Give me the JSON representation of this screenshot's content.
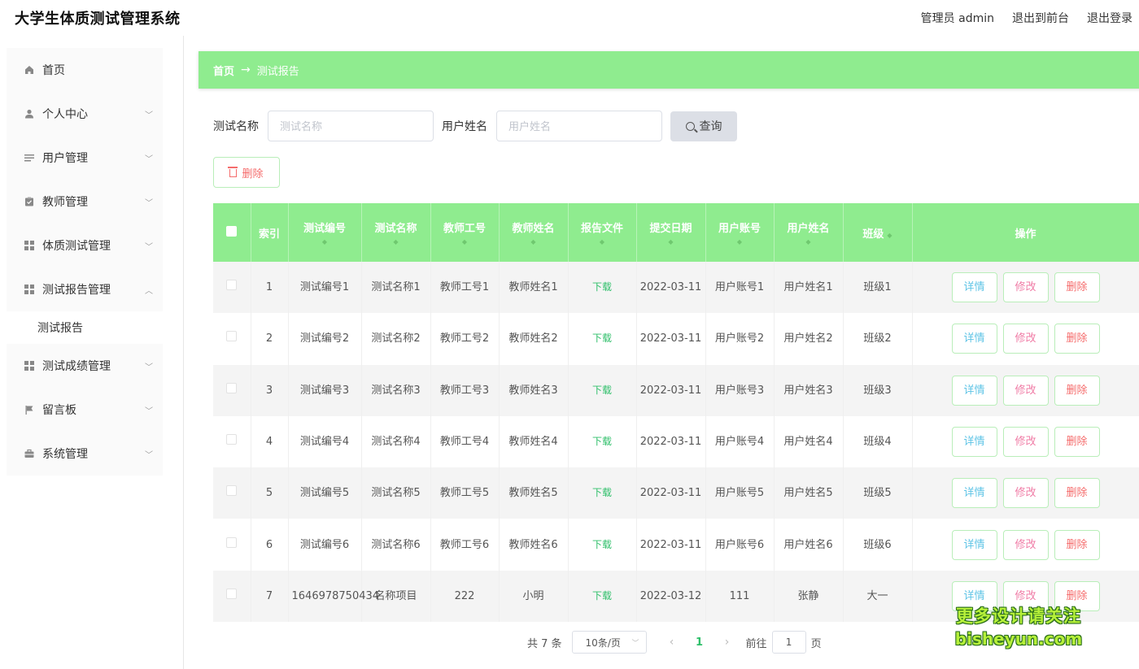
{
  "app": {
    "title": "大学生体质测试管理系统",
    "admin_label": "管理员 admin",
    "front_label": "退出到前台",
    "logout_label": "退出登录"
  },
  "sidebar": {
    "items": [
      {
        "label": "首页",
        "icon": "home-icon"
      },
      {
        "label": "个人中心",
        "icon": "user-icon"
      },
      {
        "label": "用户管理",
        "icon": "list-icon"
      },
      {
        "label": "教师管理",
        "icon": "clipboard-icon"
      },
      {
        "label": "体质测试管理",
        "icon": "grid-icon"
      },
      {
        "label": "测试报告管理",
        "icon": "grid-icon"
      },
      {
        "label": "测试报告",
        "icon": ""
      },
      {
        "label": "测试成绩管理",
        "icon": "grid-icon"
      },
      {
        "label": "留言板",
        "icon": "flag-icon"
      },
      {
        "label": "系统管理",
        "icon": "briefcase-icon"
      }
    ]
  },
  "breadcrumb": {
    "home": "首页",
    "arrow": "→",
    "current": "测试报告"
  },
  "search": {
    "name_label": "测试名称",
    "name_placeholder": "测试名称",
    "user_label": "用户姓名",
    "user_placeholder": "用户姓名",
    "query_label": "查询"
  },
  "toolbar": {
    "delete_label": "删除"
  },
  "table": {
    "headers": [
      "索引",
      "测试编号",
      "测试名称",
      "教师工号",
      "教师姓名",
      "报告文件",
      "提交日期",
      "用户账号",
      "用户姓名",
      "班级",
      "操作"
    ],
    "download_label": "下载",
    "actions": {
      "detail": "详情",
      "edit": "修改",
      "delete": "删除"
    },
    "rows": [
      {
        "index": "1",
        "test_no": "测试编号1",
        "test_name": "测试名称1",
        "teacher_no": "教师工号1",
        "teacher_name": "教师姓名1",
        "date": "2022-03-11",
        "user_account": "用户账号1",
        "user_name": "用户姓名1",
        "class": "班级1"
      },
      {
        "index": "2",
        "test_no": "测试编号2",
        "test_name": "测试名称2",
        "teacher_no": "教师工号2",
        "teacher_name": "教师姓名2",
        "date": "2022-03-11",
        "user_account": "用户账号2",
        "user_name": "用户姓名2",
        "class": "班级2"
      },
      {
        "index": "3",
        "test_no": "测试编号3",
        "test_name": "测试名称3",
        "teacher_no": "教师工号3",
        "teacher_name": "教师姓名3",
        "date": "2022-03-11",
        "user_account": "用户账号3",
        "user_name": "用户姓名3",
        "class": "班级3"
      },
      {
        "index": "4",
        "test_no": "测试编号4",
        "test_name": "测试名称4",
        "teacher_no": "教师工号4",
        "teacher_name": "教师姓名4",
        "date": "2022-03-11",
        "user_account": "用户账号4",
        "user_name": "用户姓名4",
        "class": "班级4"
      },
      {
        "index": "5",
        "test_no": "测试编号5",
        "test_name": "测试名称5",
        "teacher_no": "教师工号5",
        "teacher_name": "教师姓名5",
        "date": "2022-03-11",
        "user_account": "用户账号5",
        "user_name": "用户姓名5",
        "class": "班级5"
      },
      {
        "index": "6",
        "test_no": "测试编号6",
        "test_name": "测试名称6",
        "teacher_no": "教师工号6",
        "teacher_name": "教师姓名6",
        "date": "2022-03-11",
        "user_account": "用户账号6",
        "user_name": "用户姓名6",
        "class": "班级6"
      },
      {
        "index": "7",
        "test_no": "1646978750434",
        "test_name": "名称项目",
        "teacher_no": "222",
        "teacher_name": "小明",
        "date": "2022-03-12",
        "user_account": "111",
        "user_name": "张静",
        "class": "大一"
      }
    ]
  },
  "pagination": {
    "total": "共 7 条",
    "page_size": "10条/页",
    "prev": "‹",
    "current": "1",
    "next": "›",
    "goto_label": "前往",
    "goto_value": "1",
    "page_suffix": "页"
  },
  "watermark": {
    "line1": "更多设计请关注",
    "line2": "bisheyun.com"
  },
  "colors": {
    "accent": "#8fec8f",
    "download": "#2fbf6a",
    "danger": "#f56c6c"
  }
}
